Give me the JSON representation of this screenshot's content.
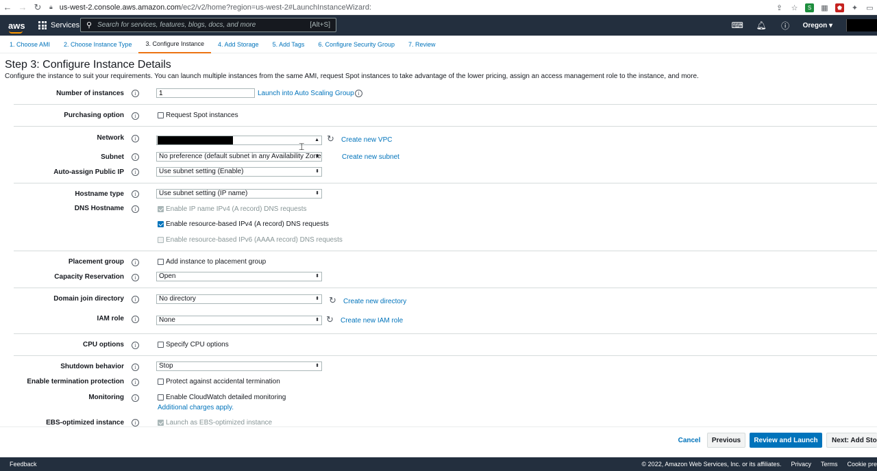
{
  "browser": {
    "url_host": "us-west-2.console.aws.amazon.com",
    "url_path": "/ec2/v2/home?region=us-west-2#LaunchInstanceWizard:"
  },
  "header": {
    "logo": "aws",
    "services_label": "Services",
    "search_placeholder": "Search for services, features, blogs, docs, and more",
    "search_shortcut": "[Alt+S]",
    "region": "Oregon"
  },
  "tabs": [
    {
      "label": "1. Choose AMI"
    },
    {
      "label": "2. Choose Instance Type"
    },
    {
      "label": "3. Configure Instance"
    },
    {
      "label": "4. Add Storage"
    },
    {
      "label": "5. Add Tags"
    },
    {
      "label": "6. Configure Security Group"
    },
    {
      "label": "7. Review"
    }
  ],
  "page": {
    "title": "Step 3: Configure Instance Details",
    "description": "Configure the instance to suit your requirements. You can launch multiple instances from the same AMI, request Spot instances to take advantage of the lower pricing, assign an access management role to the instance, and more."
  },
  "form": {
    "num_instances": {
      "label": "Number of instances",
      "value": "1",
      "link": "Launch into Auto Scaling Group"
    },
    "purchasing": {
      "label": "Purchasing option",
      "checkbox": "Request Spot instances"
    },
    "network": {
      "label": "Network",
      "link": "Create new VPC"
    },
    "subnet": {
      "label": "Subnet",
      "value": "No preference (default subnet in any Availability Zone)",
      "link": "Create new subnet"
    },
    "public_ip": {
      "label": "Auto-assign Public IP",
      "value": "Use subnet setting (Enable)"
    },
    "hostname_type": {
      "label": "Hostname type",
      "value": "Use subnet setting (IP name)"
    },
    "dns_hostname": {
      "label": "DNS Hostname",
      "opt1": "Enable IP name IPv4 (A record) DNS requests",
      "opt2": "Enable resource-based IPv4 (A record) DNS requests",
      "opt3": "Enable resource-based IPv6 (AAAA record) DNS requests"
    },
    "placement": {
      "label": "Placement group",
      "checkbox": "Add instance to placement group"
    },
    "capacity": {
      "label": "Capacity Reservation",
      "value": "Open"
    },
    "domain": {
      "label": "Domain join directory",
      "value": "No directory",
      "link": "Create new directory"
    },
    "iam": {
      "label": "IAM role",
      "value": "None",
      "link": "Create new IAM role"
    },
    "cpu": {
      "label": "CPU options",
      "checkbox": "Specify CPU options"
    },
    "shutdown": {
      "label": "Shutdown behavior",
      "value": "Stop"
    },
    "termination": {
      "label": "Enable termination protection",
      "checkbox": "Protect against accidental termination"
    },
    "monitoring": {
      "label": "Monitoring",
      "checkbox": "Enable CloudWatch detailed monitoring",
      "link": "Additional charges apply."
    },
    "ebs": {
      "label": "EBS-optimized instance",
      "checkbox": "Launch as EBS-optimized instance"
    }
  },
  "buttons": {
    "cancel": "Cancel",
    "previous": "Previous",
    "review": "Review and Launch",
    "next": "Next: Add Stor"
  },
  "footer": {
    "feedback": "Feedback",
    "copyright": "© 2022, Amazon Web Services, Inc. or its affiliates.",
    "privacy": "Privacy",
    "terms": "Terms",
    "cookie": "Cookie pre"
  }
}
